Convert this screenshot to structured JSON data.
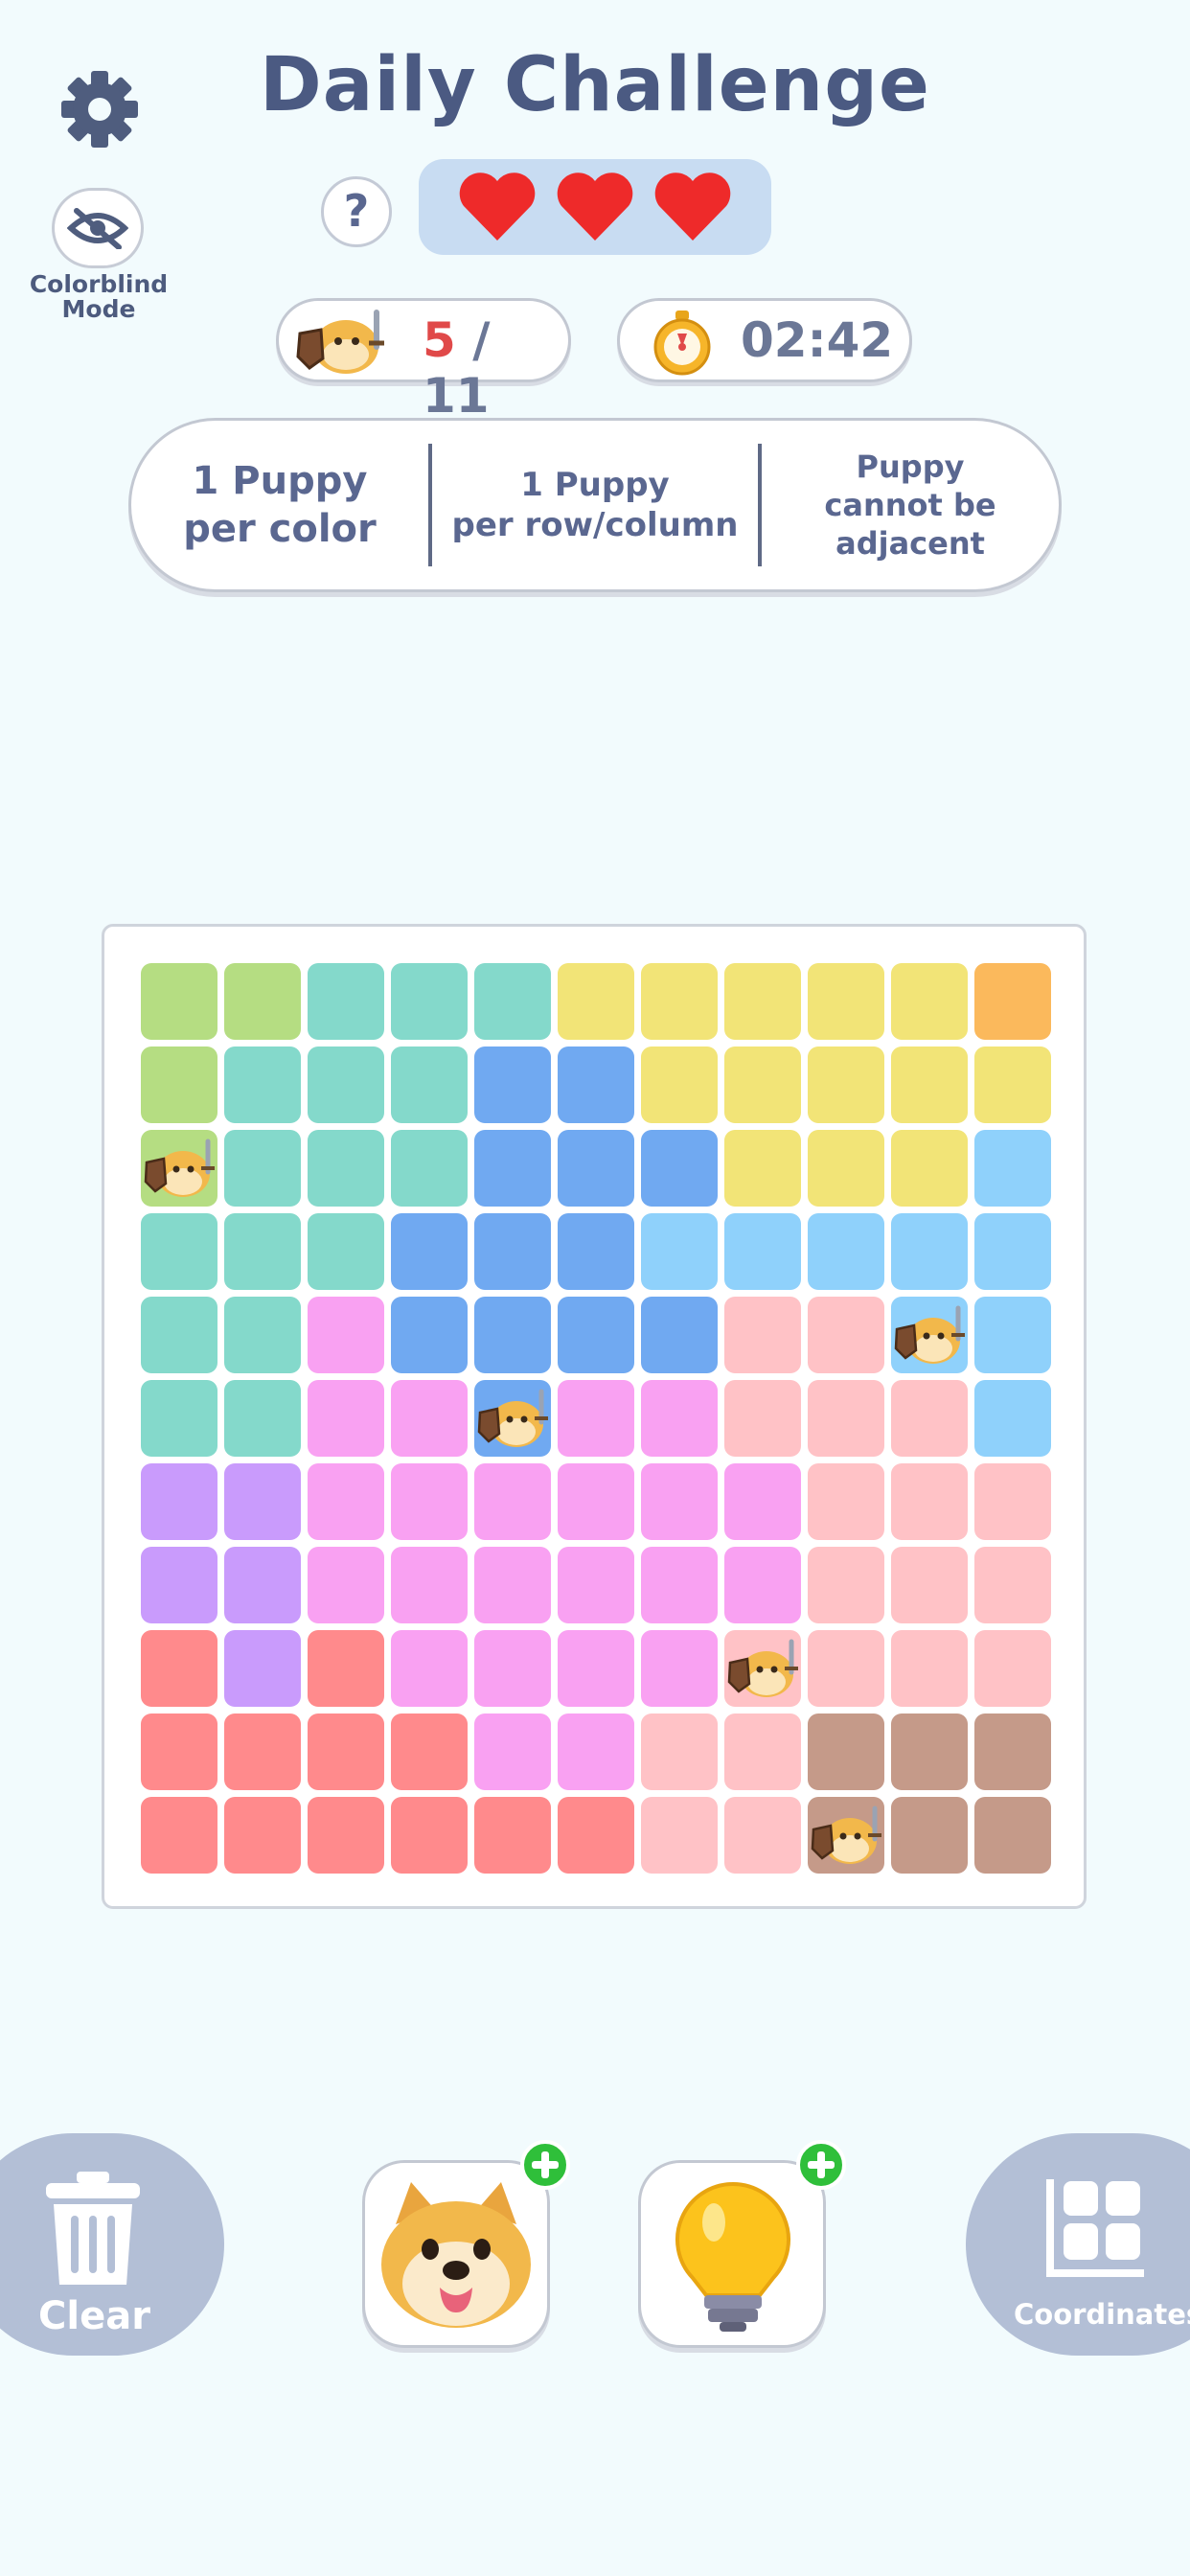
{
  "header": {
    "title": "Daily Challenge",
    "help_label": "?",
    "lives": 3,
    "colorblind_label_line1": "Colorblind",
    "colorblind_label_line2": "Mode"
  },
  "progress": {
    "current": "5",
    "sep": " / ",
    "total": "11"
  },
  "timer": {
    "value": "02:42"
  },
  "rules": [
    {
      "line1": "1 Puppy",
      "line2": "per color",
      "line3": ""
    },
    {
      "line1": "1 Puppy",
      "line2": "per row/column",
      "line3": ""
    },
    {
      "line1": "Puppy",
      "line2": "cannot be",
      "line3": "adjacent"
    }
  ],
  "board": {
    "size": 11,
    "palette": {
      "G": "#b5dd82",
      "T": "#84d9cb",
      "Y": "#f2e477",
      "O": "#fbb95c",
      "B": "#70a9f1",
      "L": "#8fd1fb",
      "P": "#f9a1f2",
      "K": "#ffc2c6",
      "V": "#c99bfc",
      "R": "#ff8a8c",
      "N": "#c59a89"
    },
    "rows": [
      "GGTTTYYYYYO",
      "GTTTBBYYYYY",
      "GTTTBBBYYYL",
      "TTTBBBLLLLL",
      "TTPBBBBKKLL",
      "TTPPBPPKKKL",
      "VVPPPPPPKKK",
      "VVPPPPPPKKK",
      "RVRPPPPKKKK",
      "RRRRPPKKNNN",
      "RRRRRRKKNNN"
    ],
    "puppies": [
      [
        2,
        0
      ],
      [
        4,
        9
      ],
      [
        5,
        4
      ],
      [
        8,
        7
      ],
      [
        10,
        8
      ]
    ]
  },
  "bottom": {
    "clear_label": "Clear",
    "coordinates_label": "Coordinates"
  },
  "icons": {
    "settings": "gear-icon",
    "colorblind": "eye-slash-icon",
    "clear": "trash-icon",
    "coordinates": "grid-icon",
    "powerup_dog": "dog-face-icon",
    "powerup_hint": "lightbulb-icon",
    "add": "plus-icon"
  }
}
